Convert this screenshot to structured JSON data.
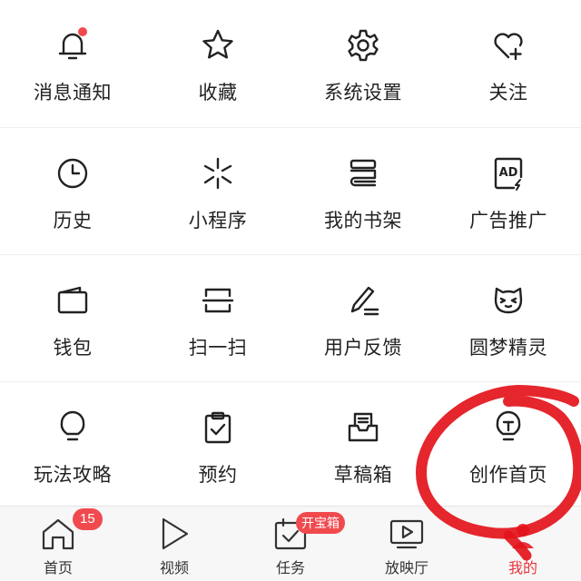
{
  "colors": {
    "accent": "#e8333c",
    "badge": "#f04a4f",
    "icon_stroke": "#222222",
    "annotation_red": "#e3141b"
  },
  "grid": {
    "rows": [
      [
        {
          "label": "消息通知",
          "icon": "bell-icon",
          "has_dot": true
        },
        {
          "label": "收藏",
          "icon": "star-icon"
        },
        {
          "label": "系统设置",
          "icon": "gear-icon"
        },
        {
          "label": "关注",
          "icon": "heart-plus-icon"
        }
      ],
      [
        {
          "label": "历史",
          "icon": "clock-icon"
        },
        {
          "label": "小程序",
          "icon": "mini-program-icon"
        },
        {
          "label": "我的书架",
          "icon": "bookshelf-icon"
        },
        {
          "label": "广告推广",
          "icon": "ad-icon",
          "icon_text": "AD"
        }
      ],
      [
        {
          "label": "钱包",
          "icon": "wallet-icon"
        },
        {
          "label": "扫一扫",
          "icon": "scan-icon"
        },
        {
          "label": "用户反馈",
          "icon": "pencil-icon"
        },
        {
          "label": "圆梦精灵",
          "icon": "cat-face-icon"
        }
      ],
      [
        {
          "label": "玩法攻略",
          "icon": "lightbulb-icon"
        },
        {
          "label": "预约",
          "icon": "clipboard-check-icon"
        },
        {
          "label": "草稿箱",
          "icon": "inbox-icon"
        },
        {
          "label": "创作首页",
          "icon": "bulb-t-icon"
        }
      ]
    ]
  },
  "tabbar": {
    "tabs": [
      {
        "label": "首页",
        "icon": "home-icon",
        "badge": "15"
      },
      {
        "label": "视频",
        "icon": "play-triangle-icon"
      },
      {
        "label": "任务",
        "icon": "task-calendar-icon",
        "badge": "开宝箱"
      },
      {
        "label": "放映厅",
        "icon": "tv-play-icon"
      },
      {
        "label": "我的",
        "icon": "profile-icon",
        "active": true
      }
    ]
  },
  "annotation": {
    "type": "hand-drawn-circle",
    "target": "创作首页"
  }
}
